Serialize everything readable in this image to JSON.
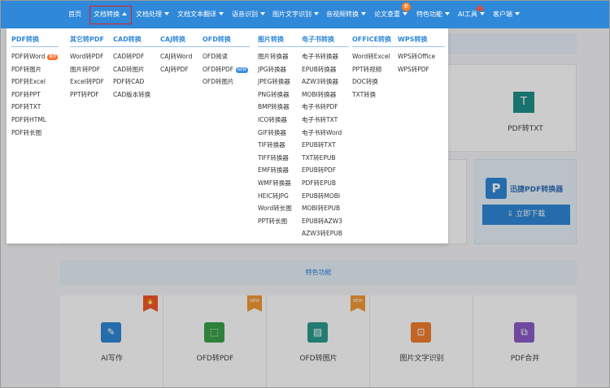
{
  "nav": {
    "items": [
      {
        "label": "首页",
        "arrow": false
      },
      {
        "label": "文档转换",
        "arrow": true,
        "active": true
      },
      {
        "label": "文档处理",
        "arrow": true
      },
      {
        "label": "文档文本翻译",
        "arrow": true
      },
      {
        "label": "语音识别",
        "arrow": true
      },
      {
        "label": "图片文字识别",
        "arrow": true
      },
      {
        "label": "音视频转换",
        "arrow": true
      },
      {
        "label": "论文查重",
        "arrow": true
      },
      {
        "label": "特色功能",
        "arrow": true
      },
      {
        "label": "AI工具",
        "arrow": true
      },
      {
        "label": "客户端",
        "arrow": true
      }
    ],
    "badge_new": "新"
  },
  "menu": {
    "columns": [
      {
        "title": "PDF转换",
        "items": [
          {
            "label": "PDF转Word",
            "tag": "推荐"
          },
          {
            "label": "PDF转图片"
          },
          {
            "label": "PDF转Excel"
          },
          {
            "label": "PDF转PPT"
          },
          {
            "label": "PDF转TXT"
          },
          {
            "label": "PDF转HTML"
          },
          {
            "label": "PDF转长图"
          }
        ]
      },
      {
        "title": "其它转PDF",
        "items": [
          {
            "label": "Word转PDF"
          },
          {
            "label": "图片转PDF"
          },
          {
            "label": "Excel转PDF"
          },
          {
            "label": "PPT转PDF"
          }
        ]
      },
      {
        "title": "CAD转换",
        "items": [
          {
            "label": "CAD转PDF"
          },
          {
            "label": "CAD转图片"
          },
          {
            "label": "PDF转CAD"
          },
          {
            "label": "CAD版本转换"
          }
        ]
      },
      {
        "title": "CAJ转换",
        "items": [
          {
            "label": "CAJ转Word"
          },
          {
            "label": "CAJ转PDF"
          }
        ]
      },
      {
        "title": "OFD转换",
        "items": [
          {
            "label": "OFD阅读"
          },
          {
            "label": "OFD转PDF",
            "tag": "NEW"
          },
          {
            "label": "OFD转图片"
          }
        ]
      },
      {
        "title": "图片转换",
        "items": [
          {
            "label": "图片转换器"
          },
          {
            "label": "JPG转换器"
          },
          {
            "label": "JPEG转换器"
          },
          {
            "label": "PNG转换器"
          },
          {
            "label": "BMP转换器"
          },
          {
            "label": "ICO转换器"
          },
          {
            "label": "GIF转换器"
          },
          {
            "label": "TIF转换器"
          },
          {
            "label": "TIFF转换器"
          },
          {
            "label": "EMF转换器"
          },
          {
            "label": "WMF转换器"
          },
          {
            "label": "HEIC转JPG"
          },
          {
            "label": "Word转长图"
          },
          {
            "label": "PPT转长图"
          }
        ]
      },
      {
        "title": "电子书转换",
        "items": [
          {
            "label": "电子书转换器"
          },
          {
            "label": "EPUB转换器"
          },
          {
            "label": "AZW3转换器"
          },
          {
            "label": "MOBI转换器"
          },
          {
            "label": "电子书转PDF"
          },
          {
            "label": "电子书转TXT"
          },
          {
            "label": "电子书转Word"
          },
          {
            "label": "EPUB转TXT"
          },
          {
            "label": "TXT转EPUB"
          },
          {
            "label": "EPUB转PDF"
          },
          {
            "label": "PDF转EPUB"
          },
          {
            "label": "EPUB转MOBI"
          },
          {
            "label": "MOBI转EPUB"
          },
          {
            "label": "EPUB转AZW3"
          },
          {
            "label": "AZW3转EPUB"
          }
        ]
      },
      {
        "title": "OFFICE转换",
        "items": [
          {
            "label": "Word转Excel"
          },
          {
            "label": "PPT转视频"
          },
          {
            "label": "DOC转换"
          },
          {
            "label": "TXT转换"
          }
        ]
      },
      {
        "title": "WPS转换",
        "items": [
          {
            "label": "WPS转Office"
          },
          {
            "label": "WPS转PDF"
          }
        ]
      }
    ]
  },
  "background": {
    "txt_card": {
      "icon": "T",
      "label": "PDF转TXT"
    },
    "promo": {
      "logo": "P",
      "name": "迅捷PDF转换器",
      "button": "立即下载"
    },
    "features_title": "特色功能",
    "tiles": [
      {
        "label": "AI写作",
        "icon_color": "#2f88d8",
        "corner": "fire"
      },
      {
        "label": "OFD转PDF",
        "icon_color": "#3aa14a",
        "corner": "NEW"
      },
      {
        "label": "OFD转图片",
        "icon_color": "#2b9c8e",
        "corner": "NEW"
      },
      {
        "label": "图片文字识别",
        "icon_color": "#f07f2c"
      },
      {
        "label": "PDF合并",
        "icon_color": "#8a5cc7"
      }
    ]
  },
  "colors": {
    "nav": "#2f88d8",
    "accent": "#2f88d8",
    "active_border": "#e02020"
  }
}
